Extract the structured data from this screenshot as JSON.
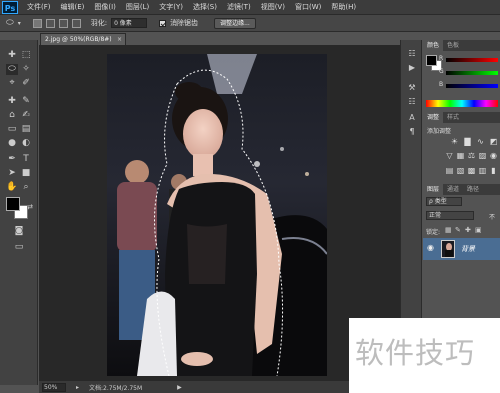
{
  "app": {
    "logo": "Ps"
  },
  "menu": [
    "文件(F)",
    "编辑(E)",
    "图像(I)",
    "图层(L)",
    "文字(Y)",
    "选择(S)",
    "滤镜(T)",
    "视图(V)",
    "窗口(W)",
    "帮助(H)"
  ],
  "options": {
    "feather_label": "羽化:",
    "feather_value": "0 像素",
    "antialias_label": "消除锯齿",
    "antialias_checked": true,
    "refine_edge_button": "调整边缘..."
  },
  "document": {
    "tab_title": "2.jpg @ 50%(RGB/8#)",
    "tab_close": "×"
  },
  "status": {
    "zoom": "50%",
    "doc_info": "文档:2.75M/2.75M"
  },
  "panels": {
    "color_tabs": [
      "颜色",
      "色板"
    ],
    "rgb_letters": [
      "R",
      "G",
      "B"
    ],
    "adjust_tabs": [
      "调整",
      "样式"
    ],
    "adjust_title": "添加调整",
    "layers_tabs": [
      "图层",
      "通道",
      "路径"
    ],
    "kind_select": "ρ 类型",
    "blend_mode": "正常",
    "opacity_label": "不",
    "lock_label": "锁定:",
    "layer_name": "背景"
  },
  "colors": {
    "foreground": "#000000",
    "background": "#ffffff",
    "layer_selected": "#4a6d93"
  },
  "watermark": "软件技巧"
}
